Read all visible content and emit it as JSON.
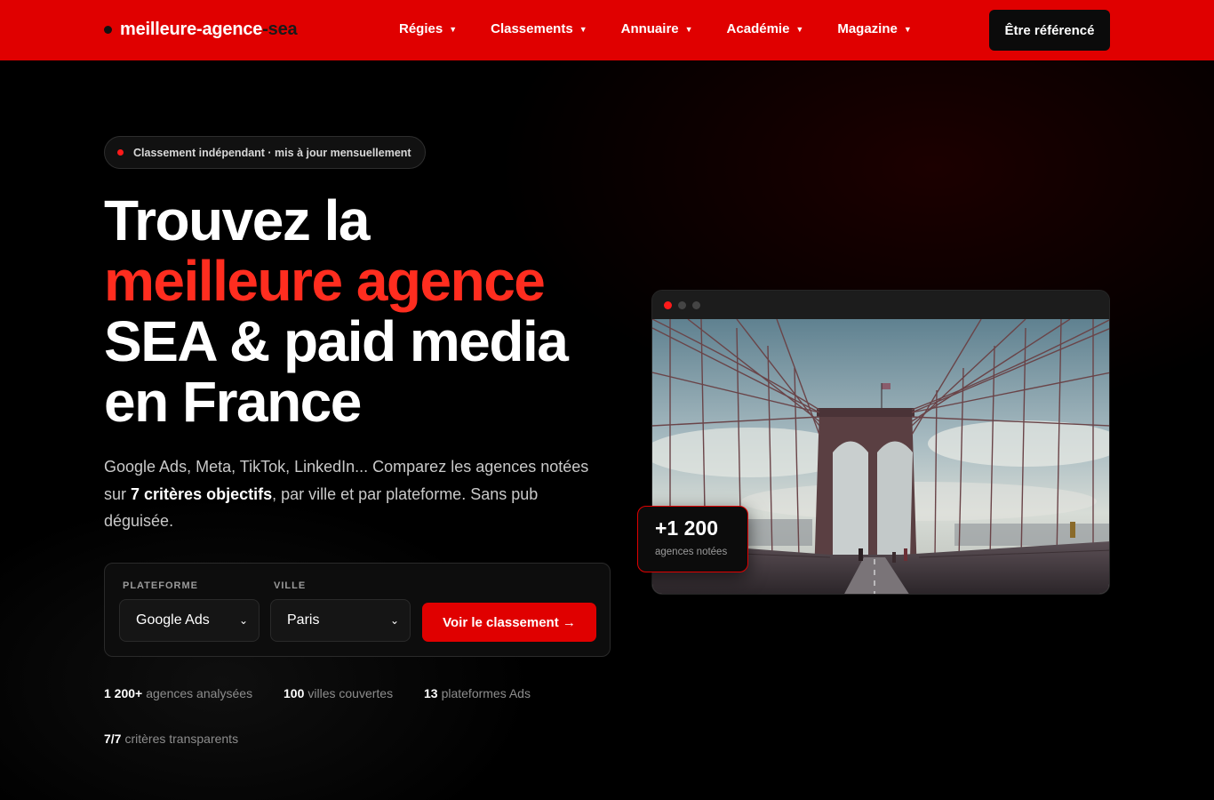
{
  "header": {
    "logo_main": "meilleure-agence",
    "logo_accent": "-sea",
    "nav": [
      {
        "label": "Régies"
      },
      {
        "label": "Classements"
      },
      {
        "label": "Annuaire"
      },
      {
        "label": "Académie"
      },
      {
        "label": "Magazine"
      }
    ],
    "cta_label": "Être référencé"
  },
  "hero": {
    "badge": "Classement indépendant · mis à jour mensuellement",
    "headline_lines": [
      "Trouvez la",
      "meilleure agence",
      "SEA & paid media",
      "en France"
    ],
    "sub_before": "Google Ads, Meta, TikTok, LinkedIn... Comparez les agences notées sur ",
    "sub_bold": "7 critères objectifs",
    "sub_after": ", par ville et par plateforme. Sans pub déguisée."
  },
  "search": {
    "platform_label": "PLATEFORME",
    "platform_value": "Google Ads",
    "city_label": "VILLE",
    "city_value": "Paris",
    "submit_label": "Voir le classement →"
  },
  "stats": [
    {
      "value": "1 200+",
      "label": "agences analysées"
    },
    {
      "value": "100",
      "label": "villes couvertes"
    },
    {
      "value": "13",
      "label": "plateformes Ads"
    },
    {
      "value": "7/7",
      "label": "critères transparents"
    }
  ],
  "card": {
    "number": "+1 200",
    "label": "agences notées"
  },
  "colors": {
    "brand_red": "#e00000",
    "accent_red": "#ff2d1f",
    "background": "#000000"
  },
  "icons": {
    "nav_caret": "caret-down-icon",
    "select_chevron": "chevron-down-icon",
    "window_dots": "window-control-icon"
  }
}
